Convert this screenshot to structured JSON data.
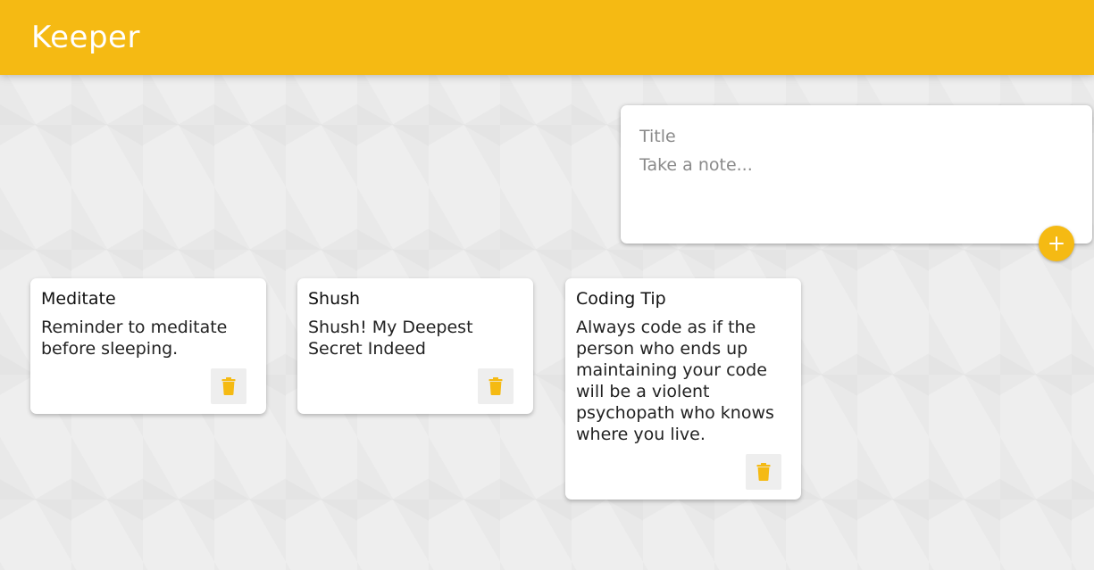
{
  "app": {
    "title": "Keeper",
    "brand_color": "#f5ba13"
  },
  "create_note": {
    "title_placeholder": "Title",
    "content_placeholder": "Take a note...",
    "add_icon": "plus-icon"
  },
  "notes": [
    {
      "title": "Meditate",
      "content": "Reminder to meditate before sleeping.",
      "delete_icon": "trash-icon"
    },
    {
      "title": "Shush",
      "content": "Shush! My Deepest Secret Indeed",
      "delete_icon": "trash-icon"
    },
    {
      "title": "Coding Tip",
      "content": "Always code as if the person who ends up maintaining your code will be a violent psychopath who knows where you live.",
      "delete_icon": "trash-icon"
    }
  ]
}
